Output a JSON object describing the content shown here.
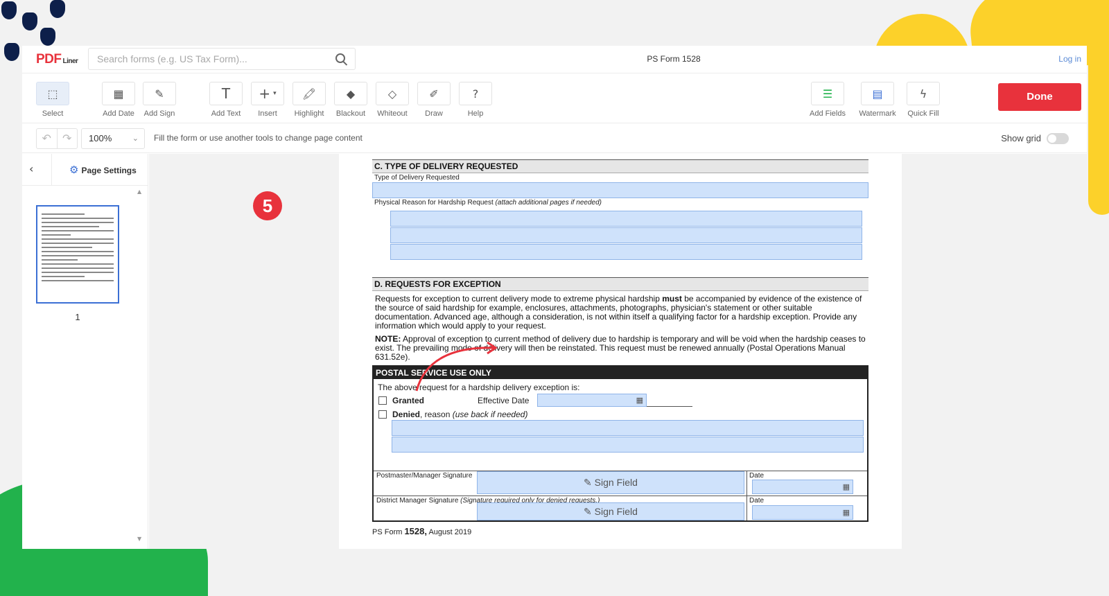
{
  "header": {
    "logo_main": "PDF",
    "logo_sub": "Liner",
    "search_placeholder": "Search forms (e.g. US Tax Form)...",
    "doc_title": "PS Form 1528",
    "login": "Log in"
  },
  "toolbar": {
    "tools": [
      {
        "label": "Select",
        "icon": "select-icon"
      },
      {
        "label": "Add Date",
        "icon": "calendar-icon"
      },
      {
        "label": "Add Sign",
        "icon": "signature-icon"
      },
      {
        "label": "Add Text",
        "icon": "text-icon"
      },
      {
        "label": "Insert",
        "icon": "plus-icon"
      },
      {
        "label": "Highlight",
        "icon": "highlighter-icon"
      },
      {
        "label": "Blackout",
        "icon": "blackout-icon"
      },
      {
        "label": "Whiteout",
        "icon": "eraser-icon"
      },
      {
        "label": "Draw",
        "icon": "pen-icon"
      },
      {
        "label": "Help",
        "icon": "question-icon"
      }
    ],
    "right_tools": [
      {
        "label": "Add Fields",
        "icon": "fields-icon"
      },
      {
        "label": "Watermark",
        "icon": "watermark-icon"
      },
      {
        "label": "Quick Fill",
        "icon": "lightning-icon"
      }
    ],
    "done_label": "Done"
  },
  "subbar": {
    "zoom": "100%",
    "hint": "Fill the form or use another tools to change page content",
    "show_grid": "Show grid"
  },
  "sidebar": {
    "page_settings": "Page Settings",
    "page_number": "1"
  },
  "form": {
    "section_c": "C. TYPE OF DELIVERY REQUESTED",
    "type_label": "Type of Delivery Requested",
    "reason_label": "Physical Reason for Hardship Request",
    "reason_note": "(attach additional pages if needed)",
    "section_d": "D. REQUESTS FOR EXCEPTION",
    "para1_a": "Requests for exception to current delivery mode to extreme physical hardship ",
    "para1_bold": "must",
    "para1_b": " be accompanied by evidence of the existence of the source of said hardship for example, enclosures, attachments, photographs, physician's statement or other suitable documentation. Advanced age, although a consideration, is not within itself a qualifying factor for a hardship exception. Provide any information which would apply to your request.",
    "note_bold": "NOTE:",
    "note_text": " Approval of exception to current method of delivery due to hardship is temporary and will be void when the hardship ceases to exist. The prevailing mode of delivery will then be reinstated. This request must be renewed annually (Postal Operations Manual 631.52e).",
    "postal_head": "POSTAL SERVICE USE ONLY",
    "postal_intro": "The above request for a hardship delivery exception is:",
    "granted": "Granted",
    "effective_date": "Effective Date",
    "denied": "Denied",
    "denied_reason": ", reason ",
    "denied_note": "(use back if needed)",
    "pm_sig": "Postmaster/Manager Signature",
    "dm_sig": "District Manager Signature ",
    "dm_note": "(Signature required only for denied requests.)",
    "date": "Date",
    "sign_field": "Sign Field",
    "footer_a": "PS Form ",
    "footer_bold": "1528,",
    "footer_b": " August 2019"
  },
  "annotation": {
    "step": "5"
  },
  "colors": {
    "brand": "#e8323c",
    "field": "#cfe2fb",
    "accent": "#3b6fd4"
  }
}
